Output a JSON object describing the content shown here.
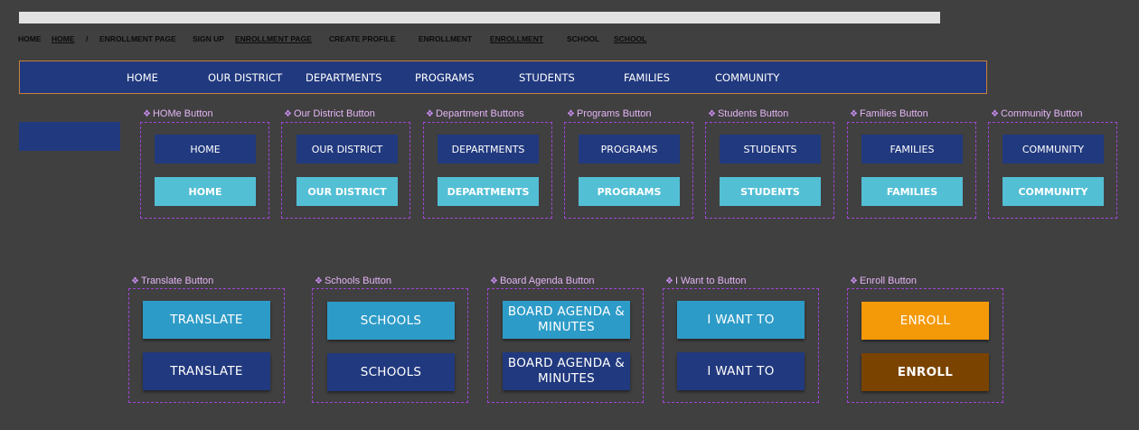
{
  "breadcrumbs": [
    {
      "text": "HOME",
      "underlined": false
    },
    {
      "text": "HOME",
      "underlined": true
    },
    {
      "text": "/",
      "underlined": false
    },
    {
      "text": "ENROLLMENT PAGE",
      "underlined": false
    },
    {
      "text": "SIGN UP",
      "underlined": false
    },
    {
      "text": "ENROLLMENT PAGE",
      "underlined": true
    },
    {
      "text": "CREATE PROFILE",
      "underlined": false
    },
    {
      "text": "ENROLLMENT",
      "underlined": false
    },
    {
      "text": "ENROLLMENT",
      "underlined": true
    },
    {
      "text": "SCHOOL",
      "underlined": false
    },
    {
      "text": "SCHOOL",
      "underlined": true
    }
  ],
  "navbar": {
    "items": [
      "HOME",
      "OUR DISTRICT",
      "DEPARTMENTS",
      "PROGRAMS",
      "STUDENTS",
      "FAMILIES",
      "COMMUNITY"
    ]
  },
  "nav_components": [
    {
      "title": "HOMe Button",
      "default_label": "HOME",
      "hover_label": "HOME"
    },
    {
      "title": "Our District Button",
      "default_label": "OUR DISTRICT",
      "hover_label": "OUR DISTRICT"
    },
    {
      "title": "Department Buttons",
      "default_label": "DEPARTMENTS",
      "hover_label": "DEPARTMENTS"
    },
    {
      "title": "Programs Button",
      "default_label": "PROGRAMS",
      "hover_label": "PROGRAMS"
    },
    {
      "title": "Students Button",
      "default_label": "STUDENTS",
      "hover_label": "STUDENTS"
    },
    {
      "title": "Families Button",
      "default_label": "FAMILIES",
      "hover_label": "FAMILIES"
    },
    {
      "title": "Community Button",
      "default_label": "COMMUNITY",
      "hover_label": "COMMUNITY"
    }
  ],
  "action_components": [
    {
      "title": "Translate Button",
      "top_label": "TRANSLATE",
      "bottom_label": "TRANSLATE"
    },
    {
      "title": "Schools Button",
      "top_label": "SCHOOLS",
      "bottom_label": "SCHOOLS"
    },
    {
      "title": "Board Agenda Button",
      "top_label": "BOARD AGENDA & MINUTES",
      "bottom_label": "BOARD AGENDA & MINUTES"
    },
    {
      "title": "I Want to Button",
      "top_label": "I WANT TO",
      "bottom_label": "I WANT TO"
    },
    {
      "title": "Enroll Button",
      "top_label": "ENROLL",
      "bottom_label": "ENROLL"
    }
  ],
  "component_glyph": "❖",
  "colors": {
    "background": "#404040",
    "navy": "#21397e",
    "cyan": "#53bfd5",
    "blue": "#2d9bc7",
    "orange": "#f49a08",
    "brown": "#7a4300",
    "component_outline": "#a046d4",
    "component_label": "#e4b5f5"
  }
}
